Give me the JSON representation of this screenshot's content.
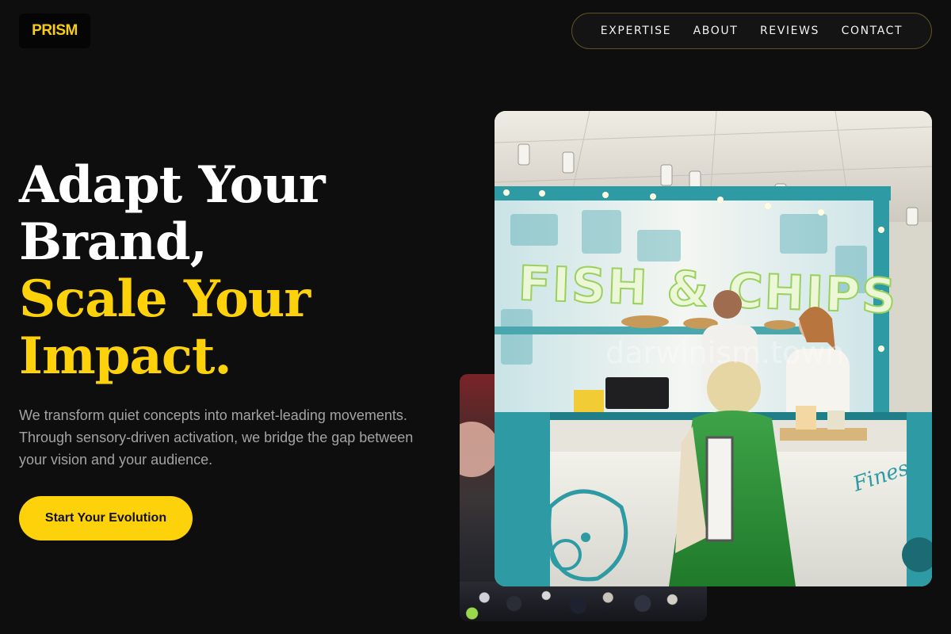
{
  "brand": {
    "logo_text": "PRISM"
  },
  "nav": {
    "items": [
      {
        "label": "EXPERTISE"
      },
      {
        "label": "ABOUT"
      },
      {
        "label": "REVIEWS"
      },
      {
        "label": "CONTACT"
      }
    ]
  },
  "hero": {
    "headline_lines": [
      "Adapt Your",
      "Brand,",
      "Scale Your",
      "Impact."
    ],
    "subtext": "We transform quiet concepts into market-leading movements. Through sensory-driven activation, we bridge the gap between your vision and your audience.",
    "cta_label": "Start Your Evolution"
  },
  "photo": {
    "sign_text": "FISH & CHIPS",
    "counter_script": "Finest in London",
    "watermark": "darwinism.town"
  },
  "colors": {
    "background": "#0e0e0e",
    "accent": "#fdd20a",
    "teal": "#2e9aa3"
  }
}
